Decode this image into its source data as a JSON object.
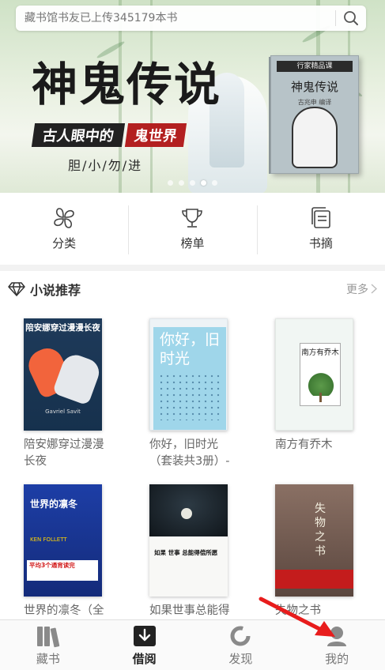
{
  "search": {
    "placeholder": "藏书馆书友已上传345179本书"
  },
  "banner": {
    "title": "神鬼传说",
    "subtitle_left": "古人眼中的",
    "subtitle_right": "鬼世界",
    "tagline": "胆/小/勿/进",
    "book_series": "行家精品课",
    "book_title": "神鬼传说",
    "book_author": "古兆申 编译",
    "dots": 5,
    "active_dot": 4
  },
  "quick_nav": [
    {
      "label": "分类",
      "icon": "category-clover-icon"
    },
    {
      "label": "榜单",
      "icon": "trophy-icon"
    },
    {
      "label": "书摘",
      "icon": "excerpt-notes-icon"
    }
  ],
  "section": {
    "title": "小说推荐",
    "more": "更多"
  },
  "books": [
    {
      "title": "陪安娜穿过漫漫长夜",
      "cover_title": "陪安娜穿过漫漫长夜",
      "cover_author": "Gavriel Savit"
    },
    {
      "title": "你好，旧时光（套装共3册）-",
      "cover_title": "你好，旧时光"
    },
    {
      "title": "南方有乔木",
      "cover_title": "南方有乔木"
    },
    {
      "title": "世界的凛冬（全",
      "cover_title": "世界的凛冬",
      "cover_author": "KEN FOLLETT",
      "cover_band": "平均3个通宵读完"
    },
    {
      "title": "如果世事总能得",
      "cover_title": "如果 世事 总能得偿所愿"
    },
    {
      "title": "失物之书",
      "cover_title": "失物之书"
    }
  ],
  "tabs": [
    {
      "label": "藏书",
      "icon": "bookshelf-icon",
      "active": false
    },
    {
      "label": "借阅",
      "icon": "borrow-download-icon",
      "active": true
    },
    {
      "label": "发现",
      "icon": "discover-icon",
      "active": false
    },
    {
      "label": "我的",
      "icon": "profile-icon",
      "active": false
    }
  ],
  "colors": {
    "accent_red": "#b32020",
    "annotation_arrow": "#e81c1c",
    "tab_active": "#222222",
    "tab_inactive": "#777777"
  }
}
